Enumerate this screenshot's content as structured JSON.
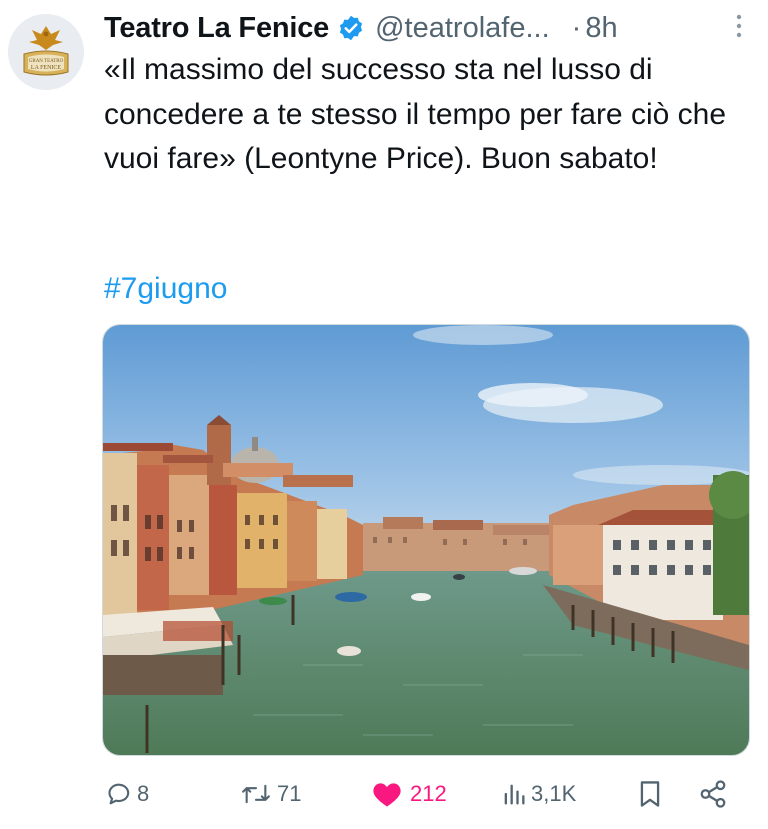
{
  "tweet": {
    "author_name": "Teatro La Fenice",
    "handle": "@teatrolafe...",
    "separator": "·",
    "time": "8h",
    "text": "«Il massimo del successo sta nel lusso di concedere a te stesso il tempo per fare ciò che vuoi fare» (Leontyne Price). Buon sabato!",
    "hashtag": "#7giugno",
    "avatar_lines": [
      "GRAN TEATRO",
      "LA FENICE"
    ]
  },
  "actions": {
    "replies": "8",
    "reposts": "71",
    "likes": "212",
    "views": "3,1K"
  },
  "icons": {
    "verified": "verified-badge-icon",
    "more": "more-options-icon",
    "reply": "reply-icon",
    "repost": "repost-icon",
    "like": "heart-icon",
    "views": "views-icon",
    "bookmark": "bookmark-icon",
    "share": "share-icon"
  },
  "colors": {
    "verified": "#1d9bf0",
    "hashtag": "#1d9bf0",
    "like": "#f91880",
    "muted": "#536471"
  }
}
